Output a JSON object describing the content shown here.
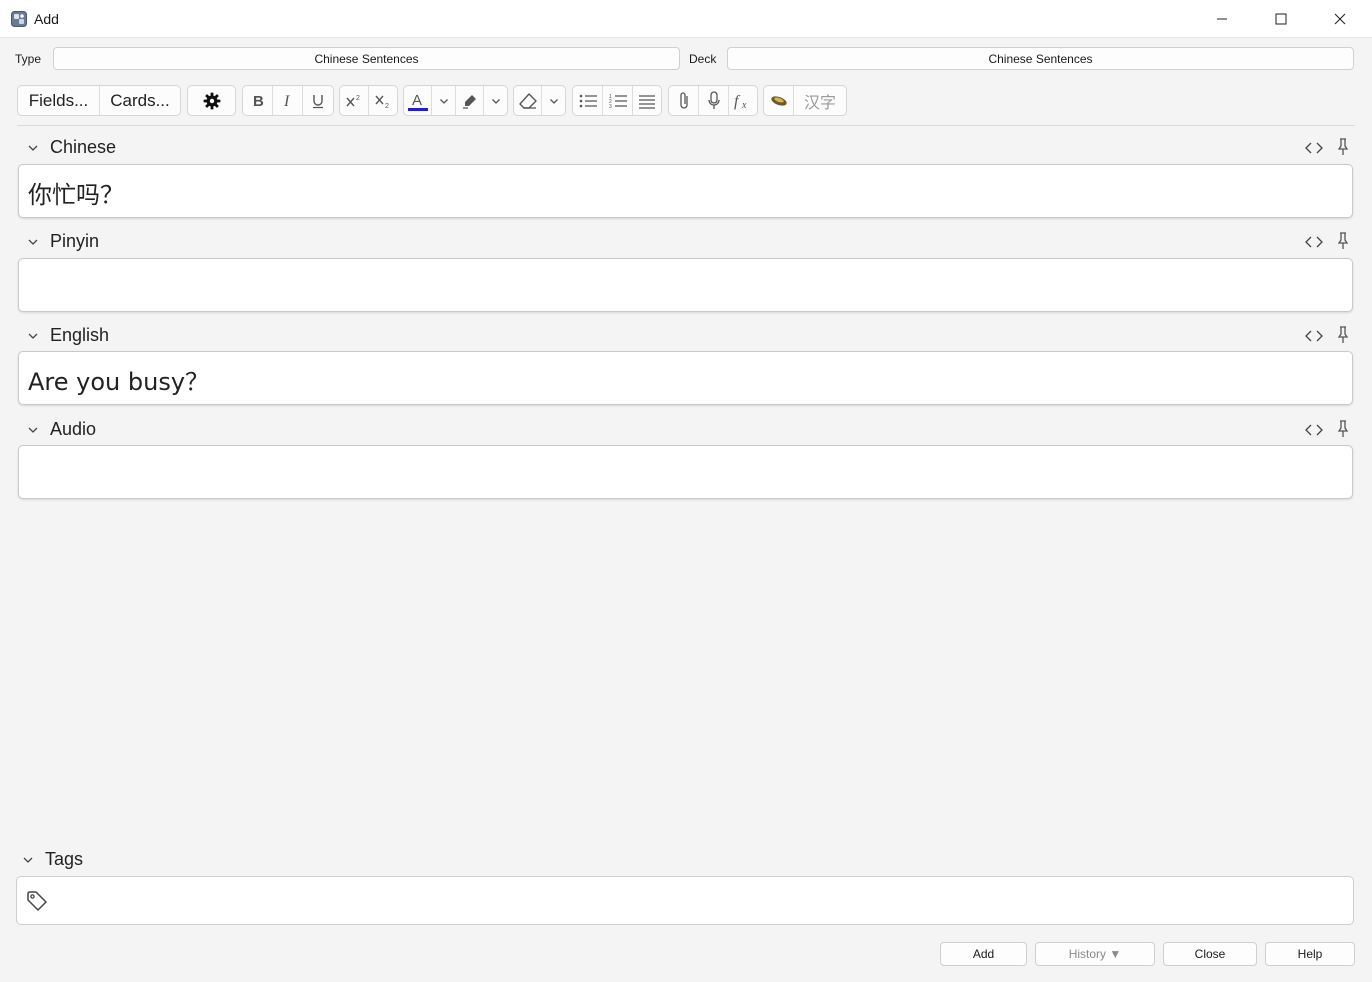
{
  "window": {
    "title": "Add",
    "minimize_icon": "minimize-icon",
    "maximize_icon": "maximize-icon",
    "close_icon": "close-icon"
  },
  "type_selector": {
    "label": "Type",
    "value": "Chinese Sentences"
  },
  "deck_selector": {
    "label": "Deck",
    "value": "Chinese Sentences"
  },
  "toolbar": {
    "fields_label": "Fields...",
    "cards_label": "Cards...",
    "chinese_label": "汉字",
    "text_color": "#1f1fd0",
    "icons": [
      "gear-icon",
      "bold-icon",
      "italic-icon",
      "underline-icon",
      "superscript-icon",
      "subscript-icon",
      "text-color-icon",
      "highlight-icon",
      "eraser-icon",
      "bullet-list-icon",
      "numbered-list-icon",
      "align-icon",
      "attach-icon",
      "microphone-icon",
      "formula-icon",
      "ink-icon"
    ]
  },
  "fields": [
    {
      "name": "Chinese",
      "value": "你忙吗？"
    },
    {
      "name": "Pinyin",
      "value": ""
    },
    {
      "name": "English",
      "value": "Are you busy？"
    },
    {
      "name": "Audio",
      "value": ""
    }
  ],
  "tags": {
    "label": "Tags",
    "value": ""
  },
  "buttons": {
    "add": "Add",
    "history": "History ▼",
    "close": "Close",
    "help": "Help"
  }
}
